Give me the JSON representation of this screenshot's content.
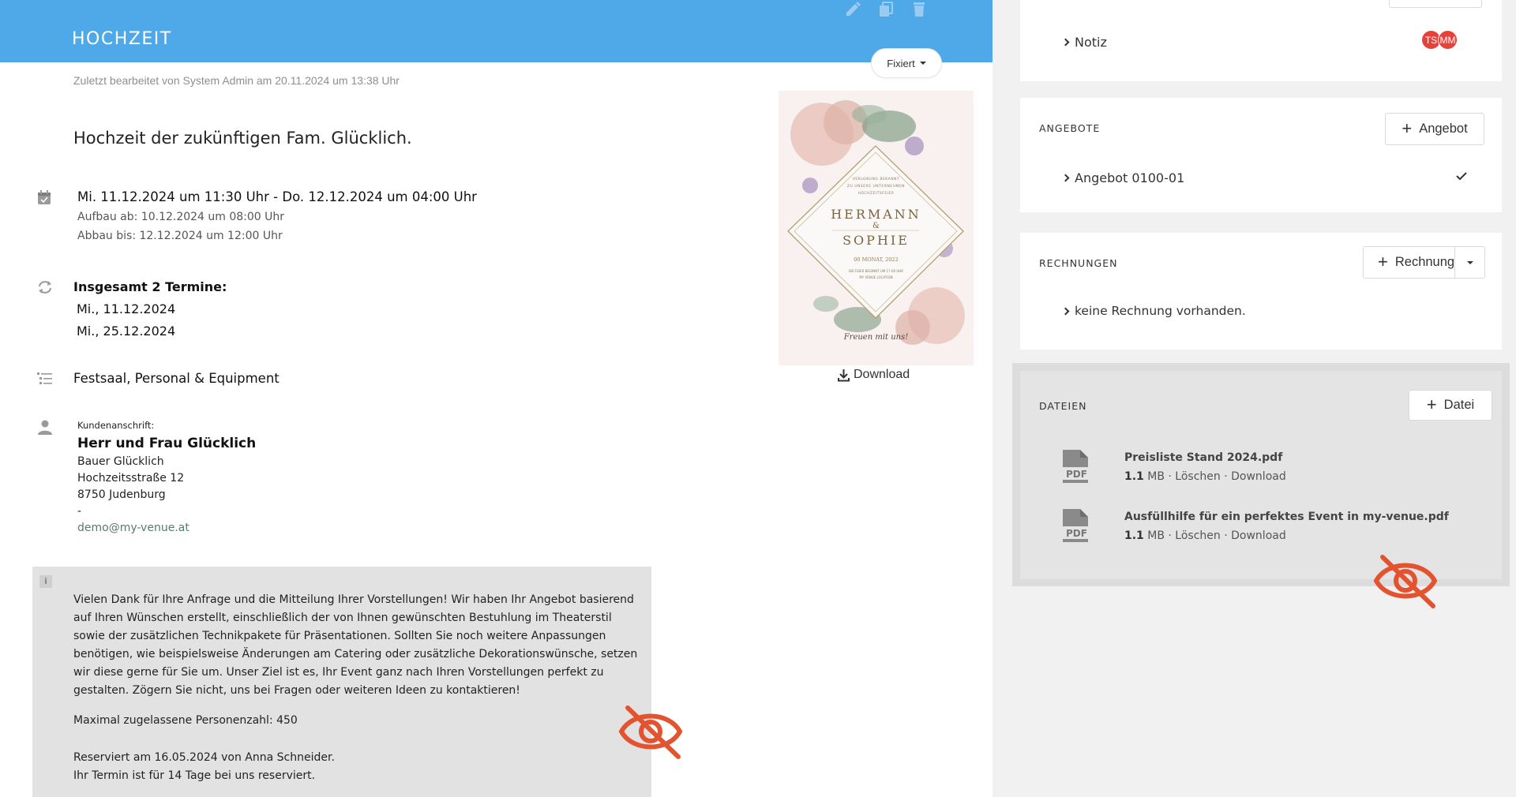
{
  "header": {
    "title": "HOCHZEIT",
    "fixiert_label": "Fixiert"
  },
  "event": {
    "last_edited": "Zuletzt bearbeitet von System Admin am 20.11.2024 um 13:38 Uhr",
    "title": "Hochzeit der zukünftigen Fam. Glücklich.",
    "date_range": "Mi. 11.12.2024 um 11:30 Uhr - Do. 12.12.2024 um 04:00 Uhr",
    "setup": "Aufbau ab: 10.12.2024 um 08:00 Uhr",
    "teardown": "Abbau bis: 12.12.2024 um 12:00 Uhr",
    "appointments_title": "Insgesamt 2 Termine:",
    "appointments": [
      "Mi., 11.12.2024",
      "Mi., 25.12.2024"
    ],
    "rooms": "Festsaal, Personal & Equipment",
    "download_label": "Download"
  },
  "customer": {
    "label": "Kundenanschrift:",
    "name": "Herr und Frau Glücklich",
    "lines": [
      "Bauer Glücklich",
      "Hochzeitsstraße 12",
      "8750 Judenburg",
      "-"
    ],
    "email": "demo@my-venue.at"
  },
  "invitation": {
    "top_text_1": "VERLOBUNG BEKANNT",
    "top_text_2": "ZU UNSERE UNTERNEHMEN",
    "top_text_3": "HOCHZEITSFEIER",
    "name1": "HERMANN",
    "amp": "&",
    "name2": "SOPHIE",
    "date": "00 MONAT, 2022",
    "small_1": "DIE FEIER BEGINNT UM 17:00 UHR",
    "small_2": "MY VENUE LOCATION",
    "script": "Freuen mit uns!"
  },
  "note": {
    "info_icon": "i",
    "paragraph": "Vielen Dank für Ihre Anfrage und die Mitteilung Ihrer Vorstellungen! Wir haben Ihr Angebot basierend auf Ihren Wünschen erstellt, einschließlich der von Ihnen gewünschten Bestuhlung im Theaterstil sowie der zusätzlichen Technikpakete für Präsentationen. Sollten Sie noch weitere Anpassungen benötigen, wie beispielsweise Änderungen am Catering oder zusätzliche Dekorationswünsche, setzen wir diese gerne für Sie um. Unser Ziel ist es, Ihr Event ganz nach Ihren Vorstellungen perfekt zu gestalten. Zögern Sie nicht, uns bei Fragen oder weiteren Ideen zu kontaktieren!",
    "max_persons": "Maximal zugelassene Personenzahl: 450",
    "reserved": "Reserviert am 16.05.2024 von Anna Schneider.",
    "reserved_days": "Ihr Termin ist für 14 Tage bei uns reserviert."
  },
  "sidebar": {
    "notiz": {
      "label": "Notiz",
      "avatars": [
        "TS",
        "MM"
      ]
    },
    "angebote": {
      "title": "ANGEBOTE",
      "button": "Angebot",
      "items": [
        {
          "label": "Angebot 0100-01"
        }
      ]
    },
    "rechnungen": {
      "title": "RECHNUNGEN",
      "button": "Rechnung",
      "empty": "keine Rechnung vorhanden."
    },
    "dateien": {
      "title": "DATEIEN",
      "button": "Datei",
      "files": [
        {
          "name": "Preisliste Stand 2024.pdf",
          "size": "1.1",
          "unit": " MB · ",
          "delete": "Löschen",
          "sep": " · ",
          "download": "Download"
        },
        {
          "name": "Ausfüllhilfe für ein perfektes Event in my-venue.pdf",
          "size": "1.1",
          "unit": " MB · ",
          "delete": "Löschen",
          "sep": " · ",
          "download": "Download"
        }
      ]
    }
  },
  "colors": {
    "header": "#4fa9e8",
    "hidden_eye": "#e4532f",
    "avatar": "#e8413a"
  },
  "icons": {
    "edit": "pencil-icon",
    "copy": "copy-icon",
    "delete": "trash-icon",
    "calendar": "calendar-icon",
    "repeat": "repeat-icon",
    "list": "list-icon",
    "person": "person-icon",
    "download": "download-icon",
    "pdf": "pdf-file-icon",
    "hidden": "eye-slash-icon"
  }
}
